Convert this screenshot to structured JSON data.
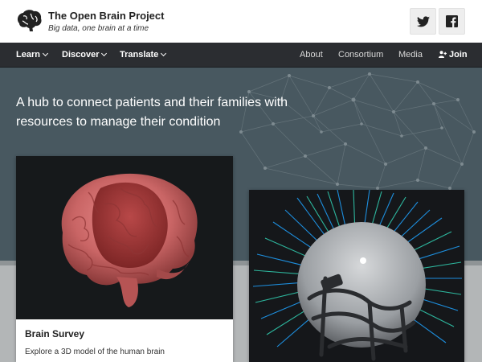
{
  "brand": {
    "title": "The Open Brain Project",
    "subtitle": "Big data, one brain at a time",
    "logo_icon": "brain-logo-icon"
  },
  "social": {
    "twitter_icon": "twitter-icon",
    "facebook_icon": "facebook-icon"
  },
  "nav": {
    "left": [
      {
        "label": "Learn",
        "dropdown": true
      },
      {
        "label": "Discover",
        "dropdown": true
      },
      {
        "label": "Translate",
        "dropdown": true
      }
    ],
    "right": [
      {
        "label": "About"
      },
      {
        "label": "Consortium"
      },
      {
        "label": "Media"
      },
      {
        "label": "Join",
        "icon": "user-plus-icon"
      }
    ]
  },
  "hero": {
    "tagline": "A hub to connect patients and their families with resources to manage their condition"
  },
  "cards": [
    {
      "title": "Brain Survey",
      "description": "Explore a 3D model of the human brain"
    }
  ],
  "colors": {
    "nav_bg": "#2b2d31",
    "hero_bg": "#485860",
    "brain_red": "#c95f5f"
  }
}
